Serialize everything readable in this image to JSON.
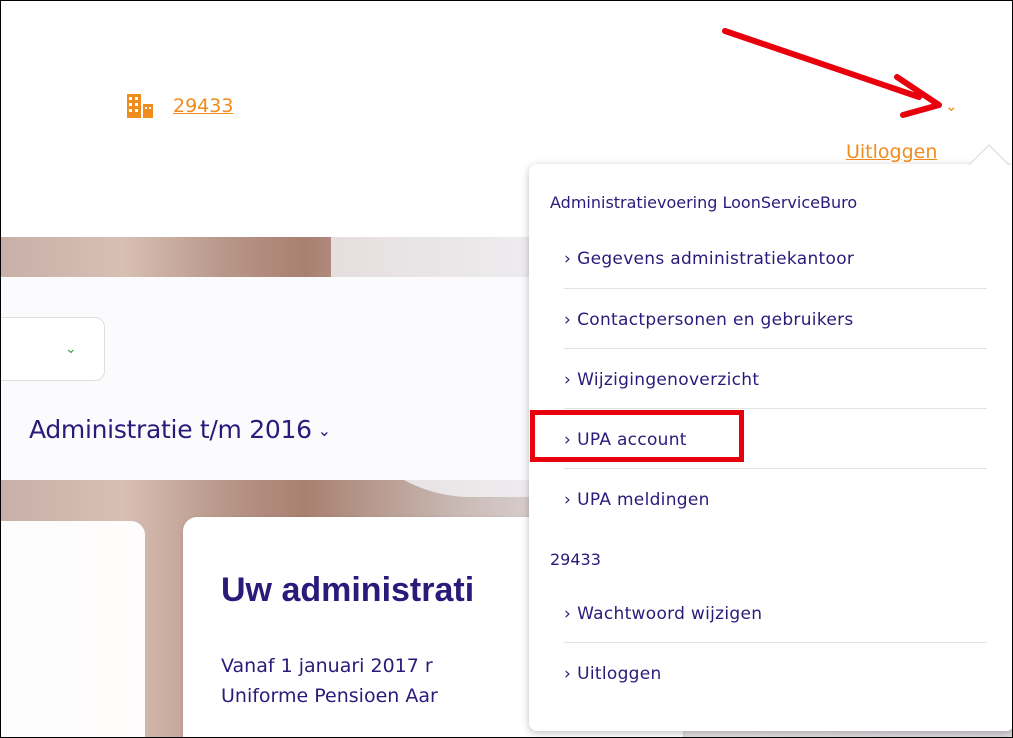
{
  "header": {
    "company_number": "29433",
    "logout_label": "Uitloggen",
    "icon": "building-icon",
    "accent_color": "#f08c1e"
  },
  "main": {
    "admin_select": {
      "label": "Administratie t/m 2016",
      "chevron": "chevron-down-icon"
    },
    "card": {
      "title": "Uw administrati",
      "line1": "Vanaf 1 januari 2017 r",
      "line2": "Uniforme Pensioen Aar"
    }
  },
  "dropdown": {
    "section1_title": "Administratievoering LoonServiceBuro",
    "section1_items": [
      "Gegevens administratiekantoor",
      "Contactpersonen en gebruikers",
      "Wijzigingenoverzicht",
      "UPA account",
      "UPA meldingen"
    ],
    "section2_title": "29433",
    "section2_items": [
      "Wachtwoord wijzigen",
      "Uitloggen"
    ],
    "item_prefix": "›",
    "highlight_color": "#e8000d"
  },
  "colors": {
    "brand_purple": "#2a1a7a",
    "annotation_red": "#e8000d"
  }
}
